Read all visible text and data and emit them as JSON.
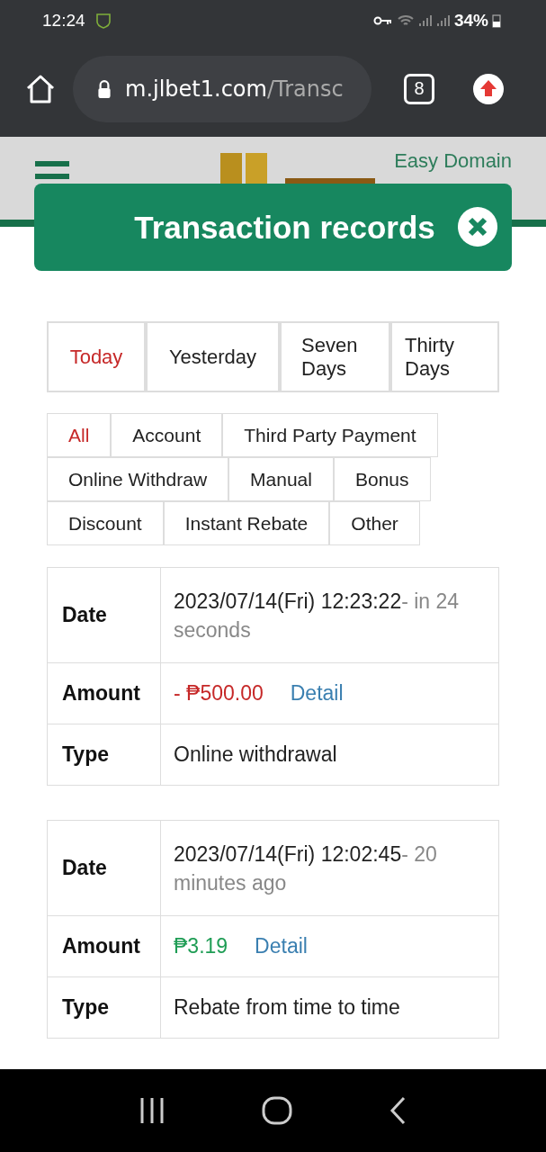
{
  "status_bar": {
    "time": "12:24",
    "battery": "34%"
  },
  "browser": {
    "url_host": "m.jlbet1.com",
    "url_path": "/Transc",
    "tab_count": "8"
  },
  "site_header": {
    "link": "Easy Domain"
  },
  "modal": {
    "title": "Transaction records"
  },
  "date_filters": [
    {
      "label": "Today",
      "selected": true
    },
    {
      "label": "Yesterday",
      "selected": false
    },
    {
      "label": "Seven Days",
      "selected": false
    },
    {
      "label": "Thirty Days",
      "selected": false
    }
  ],
  "type_filters": [
    {
      "label": "All",
      "selected": true
    },
    {
      "label": "Account",
      "selected": false
    },
    {
      "label": "Third Party Payment",
      "selected": false
    },
    {
      "label": "Online Withdraw",
      "selected": false
    },
    {
      "label": "Manual",
      "selected": false
    },
    {
      "label": "Bonus",
      "selected": false
    },
    {
      "label": "Discount",
      "selected": false
    },
    {
      "label": "Instant Rebate",
      "selected": false
    },
    {
      "label": "Other",
      "selected": false
    }
  ],
  "records": [
    {
      "date_label": "Date",
      "date": "2023/07/14(Fri) 12:23:22",
      "relative": "- in 24 seconds",
      "amount_label": "Amount",
      "amount": "- ₱500.00",
      "kind": "debit",
      "detail": "Detail",
      "type_label": "Type",
      "type": "Online withdrawal"
    },
    {
      "date_label": "Date",
      "date": "2023/07/14(Fri) 12:02:45",
      "relative": "- 20 minutes ago",
      "amount_label": "Amount",
      "amount": "₱3.19",
      "kind": "credit",
      "detail": "Detail",
      "type_label": "Type",
      "type": "Rebate from time to time"
    }
  ]
}
